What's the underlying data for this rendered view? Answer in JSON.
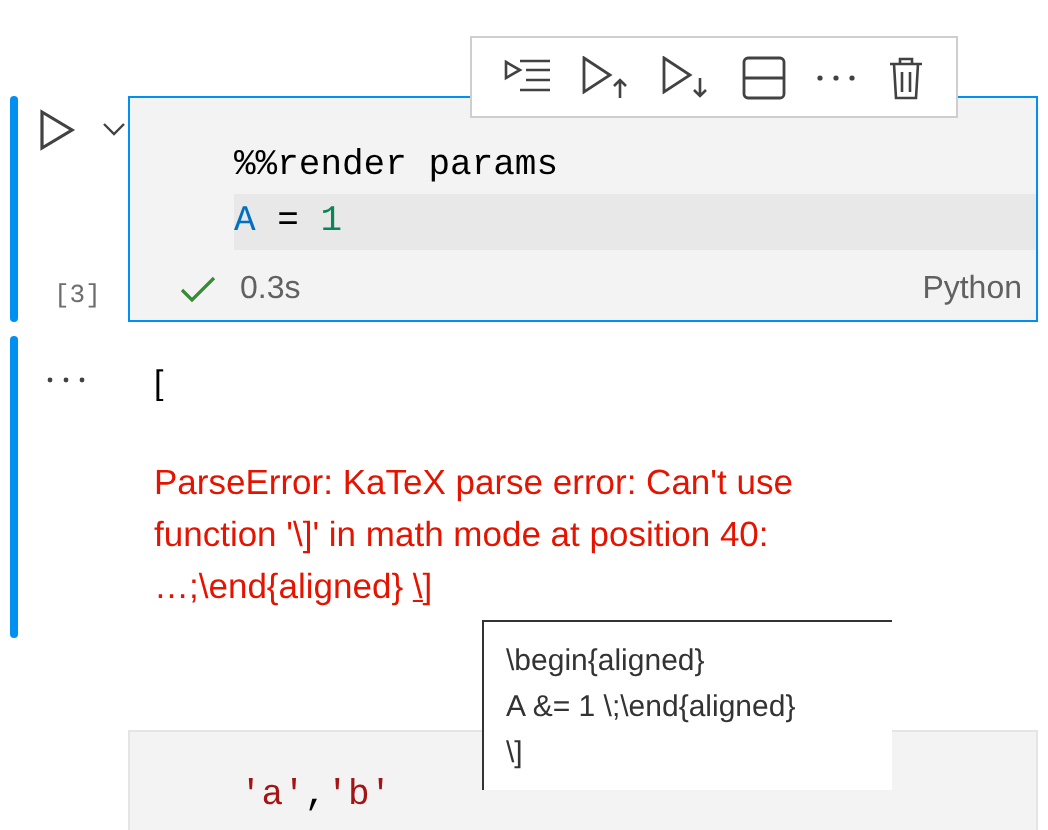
{
  "toolbar": {
    "buttons": [
      {
        "kind": "run-by-line"
      },
      {
        "kind": "run-above"
      },
      {
        "kind": "run-below"
      },
      {
        "kind": "split"
      },
      {
        "kind": "more"
      },
      {
        "kind": "delete"
      }
    ]
  },
  "code_cell": {
    "selected": true,
    "execution_count": "[3]",
    "lines": [
      [
        {
          "kind": "plain",
          "text": "%%render params"
        }
      ],
      [
        {
          "kind": "variable",
          "text": "A"
        },
        {
          "kind": "plain",
          "text": " = "
        },
        {
          "kind": "number",
          "text": "1"
        }
      ]
    ],
    "succeeded": true,
    "duration": "0.3s",
    "language": "Python"
  },
  "output": {
    "lines": [
      "["
    ],
    "error": "ParseError: KaTeX parse error: Can't use function '\\]' in math mode at position 40: …;\\end{aligned} ",
    "error_link": "\\]"
  },
  "tooltip": {
    "lines": [
      "\\begin{aligned}",
      "A &= 1 \\;\\end{aligned}",
      "\\]"
    ]
  },
  "next_cell": {
    "lines": [
      [
        {
          "kind": "string",
          "text": "'a'"
        },
        {
          "kind": "plain",
          "text": ","
        },
        {
          "kind": "string",
          "text": "'b'"
        }
      ]
    ]
  }
}
